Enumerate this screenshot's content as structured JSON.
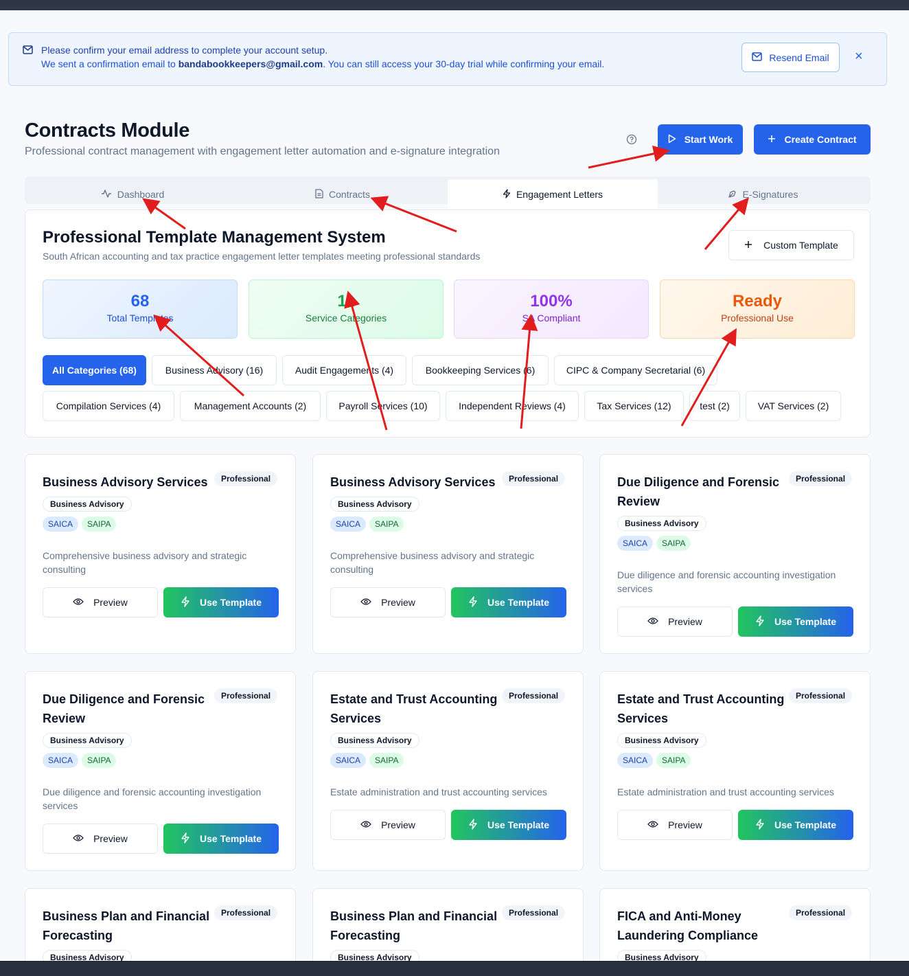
{
  "alert": {
    "line1": "Please confirm your email address to complete your account setup.",
    "line2_prefix": "We sent a confirmation email to ",
    "email": "bandabookkeepers@gmail.com",
    "line2_suffix": ". You can still access your 30-day trial while confirming your email.",
    "resend_label": "Resend Email"
  },
  "header": {
    "title": "Contracts Module",
    "subtitle": "Professional contract management with engagement letter automation and e-signature integration",
    "start_work": "Start Work",
    "create_contract": "Create Contract"
  },
  "tabs": [
    "Dashboard",
    "Contracts",
    "Engagement Letters",
    "E-Signatures"
  ],
  "active_tab": "Engagement Letters",
  "templates": {
    "title": "Professional Template Management System",
    "subtitle": "South African accounting and tax practice engagement letter templates meeting professional standards",
    "custom_template": "Custom Template",
    "stats": [
      {
        "value": "68",
        "label": "Total Templates"
      },
      {
        "value": "11",
        "label": "Service Categories"
      },
      {
        "value": "100%",
        "label": "SA Compliant"
      },
      {
        "value": "Ready",
        "label": "Professional Use"
      }
    ],
    "categories": [
      "All Categories (68)",
      "Business Advisory (16)",
      "Audit Engagements (4)",
      "Bookkeeping Services (6)",
      "CIPC & Company Secretarial (6)",
      "Compilation Services (4)",
      "Management Accounts (2)",
      "Payroll Services (10)",
      "Independent Reviews (4)",
      "Tax Services (12)",
      "test (2)",
      "VAT Services (2)"
    ]
  },
  "cards": [
    {
      "title": "Business Advisory Services",
      "badge": "Professional",
      "category": "Business Advisory",
      "tags": [
        "SAICA",
        "SAIPA"
      ],
      "description": "Comprehensive business advisory and strategic consulting",
      "preview": "Preview",
      "use": "Use Template"
    },
    {
      "title": "Business Advisory Services",
      "badge": "Professional",
      "category": "Business Advisory",
      "tags": [
        "SAICA",
        "SAIPA"
      ],
      "description": "Comprehensive business advisory and strategic consulting",
      "preview": "Preview",
      "use": "Use Template"
    },
    {
      "title": "Due Diligence and Forensic Review",
      "badge": "Professional",
      "category": "Business Advisory",
      "tags": [
        "SAICA",
        "SAIPA"
      ],
      "description": "Due diligence and forensic accounting investigation services",
      "preview": "Preview",
      "use": "Use Template"
    },
    {
      "title": "Due Diligence and Forensic Review",
      "badge": "Professional",
      "category": "Business Advisory",
      "tags": [
        "SAICA",
        "SAIPA"
      ],
      "description": "Due diligence and forensic accounting investigation services",
      "preview": "Preview",
      "use": "Use Template"
    },
    {
      "title": "Estate and Trust Accounting Services",
      "badge": "Professional",
      "category": "Business Advisory",
      "tags": [
        "SAICA",
        "SAIPA"
      ],
      "description": "Estate administration and trust accounting services",
      "preview": "Preview",
      "use": "Use Template"
    },
    {
      "title": "Estate and Trust Accounting Services",
      "badge": "Professional",
      "category": "Business Advisory",
      "tags": [
        "SAICA",
        "SAIPA"
      ],
      "description": "Estate administration and trust accounting services",
      "preview": "Preview",
      "use": "Use Template"
    },
    {
      "title": "Business Plan and Financial Forecasting",
      "badge": "Professional",
      "category": "Business Advisory"
    },
    {
      "title": "Business Plan and Financial Forecasting",
      "badge": "Professional",
      "category": "Business Advisory"
    },
    {
      "title": "FICA and Anti-Money Laundering Compliance",
      "badge": "Professional",
      "category": "Business Advisory"
    }
  ]
}
